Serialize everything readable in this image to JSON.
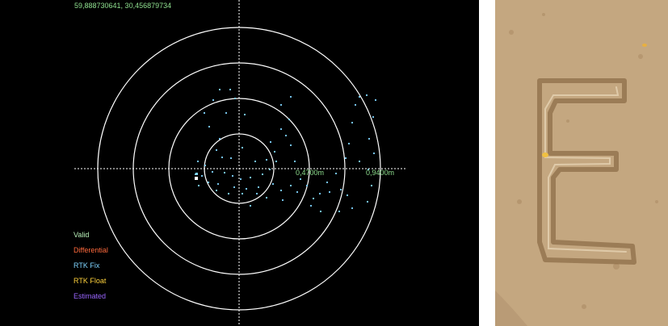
{
  "header": {
    "coordinates": "59,888730641, 30,456879734"
  },
  "axis": {
    "labels": [
      "0,4700m",
      "0,9400m"
    ]
  },
  "legend": {
    "items": [
      {
        "label": "Valid",
        "color": "#b8f0b8"
      },
      {
        "label": "Differential",
        "color": "#ff6a3d"
      },
      {
        "label": "RTK Fix",
        "color": "#7fd4ff"
      },
      {
        "label": "RTK Float",
        "color": "#ffd23c"
      },
      {
        "label": "Estimated",
        "color": "#9a66ff"
      }
    ]
  },
  "colors": {
    "background": "#000000",
    "rings": "#ffffff",
    "points": "#7fd4ff",
    "axis_label": "#8fe08f",
    "sand": "#c9ad85"
  }
}
